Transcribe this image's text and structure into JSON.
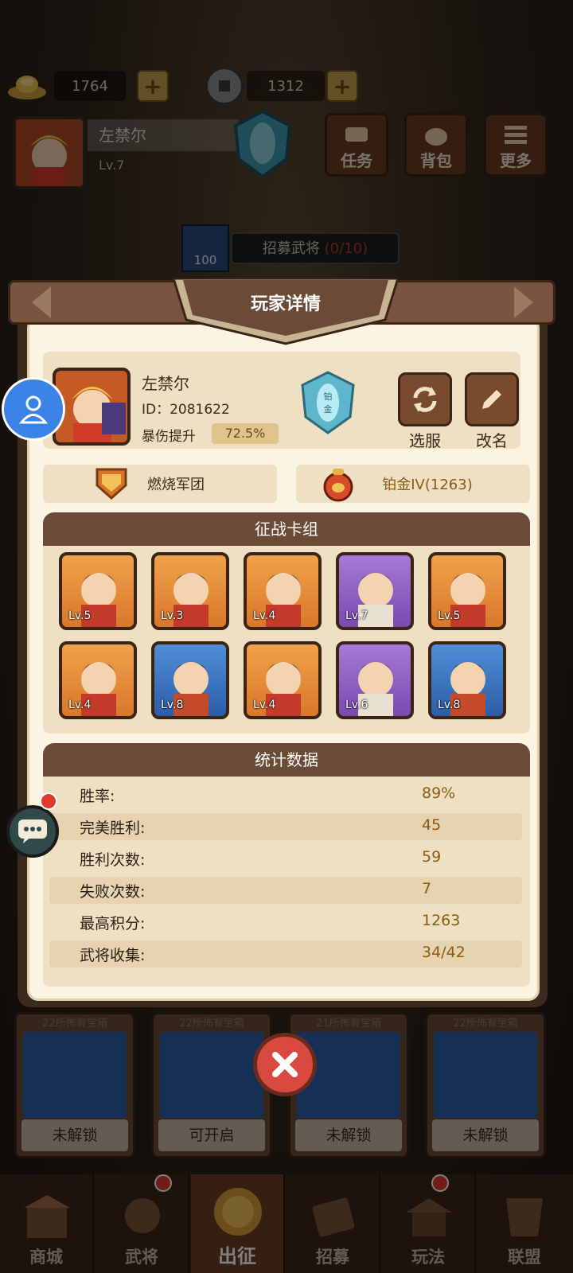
{
  "hud": {
    "gold_amount": "1764",
    "coin_amount": "1312",
    "player_name": "左禁尔",
    "player_level": "Lv.7",
    "rank_short": "铂\n金",
    "buttons": [
      {
        "label": "任务",
        "icon": "scroll-icon"
      },
      {
        "label": "背包",
        "icon": "bag-icon"
      },
      {
        "label": "更多",
        "icon": "menu-icon"
      }
    ],
    "recruit": {
      "cost": "100",
      "label": "招募武将",
      "progress": "(0/10)"
    }
  },
  "dialog": {
    "title": "玩家详情",
    "profile": {
      "name": "左禁尔",
      "id": "ID：2081622",
      "crit_label": "暴伤提升",
      "crit_value": "72.5%",
      "rank_emblem_text": "铂\n金",
      "select_server_label": "选服",
      "rename_label": "改名"
    },
    "guild_name": "燃烧军团",
    "rank_label": "铂金IV(1263)",
    "deck": {
      "title": "征战卡组",
      "cards": [
        {
          "level": "Lv.5",
          "rarity": "orange"
        },
        {
          "level": "Lv.3",
          "rarity": "orange"
        },
        {
          "level": "Lv.4",
          "rarity": "orange"
        },
        {
          "level": "Lv.7",
          "rarity": "purple"
        },
        {
          "level": "Lv.5",
          "rarity": "orange"
        },
        {
          "level": "Lv.4",
          "rarity": "orange"
        },
        {
          "level": "Lv.8",
          "rarity": "blue"
        },
        {
          "level": "Lv.4",
          "rarity": "orange"
        },
        {
          "level": "Lv.6",
          "rarity": "purple"
        },
        {
          "level": "Lv.8",
          "rarity": "blue"
        }
      ]
    },
    "stats": {
      "title": "统计数据",
      "rows": [
        {
          "label": "胜率:",
          "value": "89%"
        },
        {
          "label": "完美胜利:",
          "value": "45"
        },
        {
          "label": "胜利次数:",
          "value": "59"
        },
        {
          "label": "失败次数:",
          "value": "7"
        },
        {
          "label": "最高积分:",
          "value": "1263"
        },
        {
          "label": "武将收集:",
          "value": "34/42"
        }
      ]
    }
  },
  "chests": [
    {
      "header": "22所怖有宝箱",
      "status": "未解锁"
    },
    {
      "header": "22所怖有宝箱",
      "status": "可开启"
    },
    {
      "header": "21所怖有宝箱",
      "status": "未解锁"
    },
    {
      "header": "22所怖有宝箱",
      "status": "未解锁"
    }
  ],
  "nav": [
    {
      "label": "商城",
      "icon": "shop-icon"
    },
    {
      "label": "武将",
      "icon": "general-icon",
      "badge": true
    },
    {
      "label": "出征",
      "icon": "battle-icon",
      "active": true
    },
    {
      "label": "招募",
      "icon": "recruit-icon"
    },
    {
      "label": "玩法",
      "icon": "gameplay-icon",
      "badge": true
    },
    {
      "label": "联盟",
      "icon": "alliance-icon"
    }
  ],
  "colors": {
    "frame": "#3c2a1e",
    "panel": "#fbf3e3",
    "header": "#6b4a36",
    "value_gold": "#8a5a10",
    "orange_card": "#e08a36",
    "purple_card": "#8f5fc4",
    "blue_card": "#3a76c2"
  }
}
